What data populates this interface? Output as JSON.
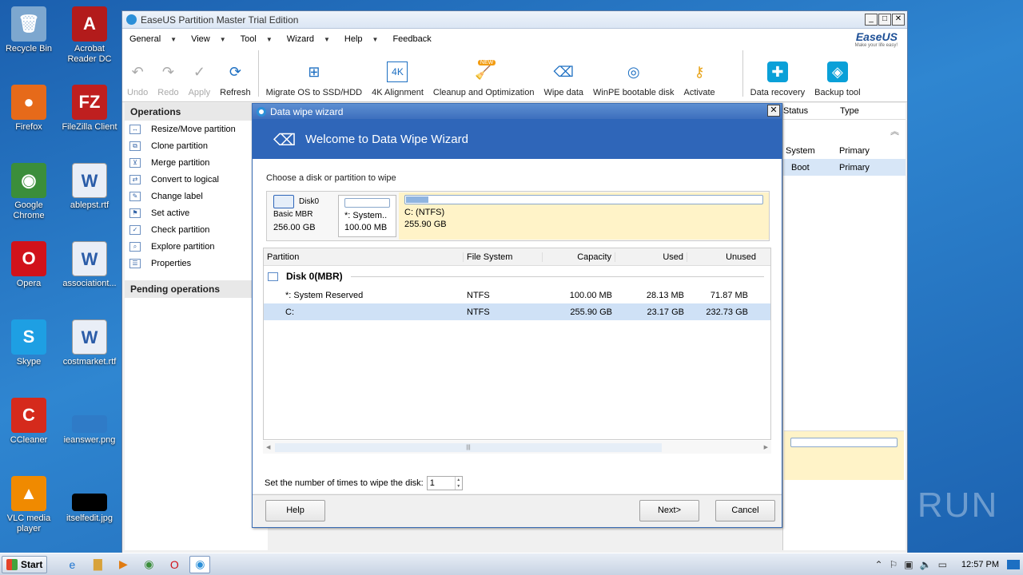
{
  "desktop": {
    "icons": [
      {
        "label": "Recycle Bin",
        "icon": "recycle-bin-icon",
        "glyph": "🗑",
        "color": "#7da7cf"
      },
      {
        "label": "Acrobat Reader DC",
        "icon": "acrobat-icon",
        "glyph": "A",
        "color": "#b31b1b"
      },
      {
        "label": "Firefox",
        "icon": "firefox-icon",
        "glyph": "●",
        "color": "#e66a1a"
      },
      {
        "label": "FileZilla Client",
        "icon": "filezilla-icon",
        "glyph": "FZ",
        "color": "#bf1f1f"
      },
      {
        "label": "Google Chrome",
        "icon": "chrome-icon",
        "glyph": "◉",
        "color": "#3b8e3b"
      },
      {
        "label": "ablepst.rtf",
        "icon": "word-doc-icon",
        "glyph": "W",
        "color": "#e9eef7"
      },
      {
        "label": "Opera",
        "icon": "opera-icon",
        "glyph": "O",
        "color": "#d1121b"
      },
      {
        "label": "associationt...",
        "icon": "word-doc-icon",
        "glyph": "W",
        "color": "#e9eef7"
      },
      {
        "label": "Skype",
        "icon": "skype-icon",
        "glyph": "S",
        "color": "#1e9fe3"
      },
      {
        "label": "costmarket.rtf",
        "icon": "word-doc-icon",
        "glyph": "W",
        "color": "#e9eef7"
      },
      {
        "label": "CCleaner",
        "icon": "ccleaner-icon",
        "glyph": "C",
        "color": "#d52a1c"
      },
      {
        "label": "ieanswer.png",
        "icon": "image-file-icon",
        "glyph": "",
        "color": "#2f7bc7"
      },
      {
        "label": "VLC media player",
        "icon": "vlc-icon",
        "glyph": "▲",
        "color": "#f08a00"
      },
      {
        "label": "itselfedit.jpg",
        "icon": "image-file-icon",
        "glyph": "",
        "color": "#000000"
      }
    ]
  },
  "app": {
    "title": "EaseUS Partition Master Trial Edition",
    "menu": [
      "General",
      "View",
      "Tool",
      "Wizard",
      "Help",
      "Feedback"
    ],
    "logo_text": "EaseUS",
    "logo_tagline": "Make your life easy!",
    "toolbar": {
      "undo": "Undo",
      "redo": "Redo",
      "apply": "Apply",
      "refresh": "Refresh",
      "migrate": "Migrate OS to SSD/HDD",
      "align": "4K Alignment",
      "cleanup": "Cleanup and Optimization",
      "new_badge": "NEW",
      "wipe": "Wipe data",
      "winpe": "WinPE bootable disk",
      "activate": "Activate",
      "recovery": "Data recovery",
      "backup": "Backup tool",
      "align_glyph": "4K"
    },
    "operations_title": "Operations",
    "operations": [
      "Resize/Move partition",
      "Clone partition",
      "Merge partition",
      "Convert to logical",
      "Change label",
      "Set active",
      "Check partition",
      "Explore partition",
      "Properties"
    ],
    "pending_title": "Pending operations",
    "right_headers": [
      "Status",
      "Type"
    ],
    "right_rows": [
      [
        "System",
        "Primary"
      ],
      [
        "Boot",
        "Primary"
      ]
    ]
  },
  "dialog": {
    "title": "Data wipe wizard",
    "banner": "Welcome to Data Wipe Wizard",
    "choose_label": "Choose a disk or partition to wipe",
    "disk": {
      "name": "Disk0",
      "type": "Basic MBR",
      "size": "256.00 GB"
    },
    "map_parts": [
      {
        "label": "*: System..",
        "size": "100.00 MB",
        "used_fraction": 0
      },
      {
        "label": "C: (NTFS)",
        "size": "255.90 GB",
        "used_fraction": 0.06
      }
    ],
    "columns": [
      "Partition",
      "File System",
      "Capacity",
      "Used",
      "Unused"
    ],
    "group": "Disk 0(MBR)",
    "rows": [
      {
        "partition": "*: System Reserved",
        "fs": "NTFS",
        "capacity": "100.00 MB",
        "used": "28.13 MB",
        "unused": "71.87 MB"
      },
      {
        "partition": "C:",
        "fs": "NTFS",
        "capacity": "255.90 GB",
        "used": "23.17 GB",
        "unused": "232.73 GB"
      }
    ],
    "times_label": "Set the number of times to wipe the disk:",
    "times_value": "1",
    "help": "Help",
    "next": "Next>",
    "cancel": "Cancel"
  },
  "taskbar": {
    "start": "Start",
    "clock": "12:57 PM"
  },
  "watermark": "ANY RUN"
}
